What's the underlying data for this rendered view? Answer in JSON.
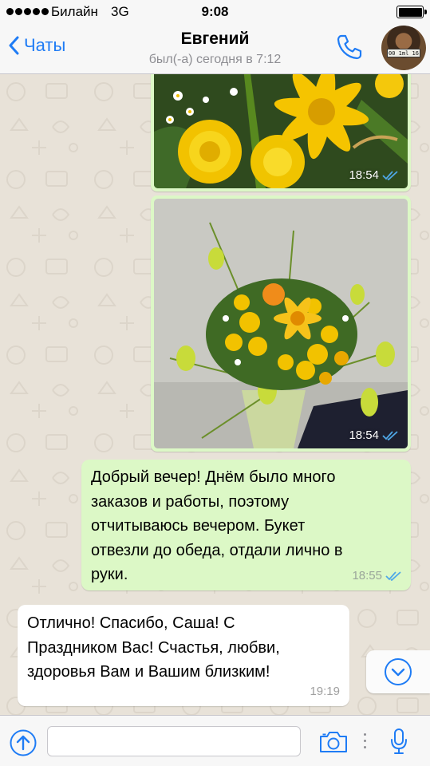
{
  "status_bar": {
    "carrier": "Билайн",
    "network": "3G",
    "time": "9:08"
  },
  "header": {
    "back_label": "Чаты",
    "contact_name": "Евгений",
    "last_seen": "был(-а) сегодня в 7:12",
    "avatar_plate": "00 1ml 16"
  },
  "messages": [
    {
      "type": "image",
      "direction": "outgoing",
      "subject": "yellow-flowers-closeup",
      "time": "18:54",
      "status": "read"
    },
    {
      "type": "image",
      "direction": "outgoing",
      "subject": "yellow-bouquet",
      "time": "18:54",
      "status": "read"
    },
    {
      "type": "text",
      "direction": "outgoing",
      "lines": [
        "Добрый вечер! Днём было много",
        "заказов и работы, поэтому",
        "отчитываюсь вечером. Букет",
        "отвезли до обеда, отдали лично в",
        "руки."
      ],
      "time": "18:55",
      "status": "read"
    },
    {
      "type": "text",
      "direction": "incoming",
      "lines": [
        "Отлично! Спасибо, Саша! С",
        "Праздником Вас! Счастья, любви,",
        "здоровья Вам и Вашим близким!"
      ],
      "time": "19:19"
    }
  ],
  "input": {
    "placeholder": ""
  },
  "colors": {
    "accent": "#1f7cf5",
    "outgoing_bubble": "#dcf8c6",
    "incoming_bubble": "#ffffff",
    "wallpaper": "#e8e2d8",
    "read_ticks": "#4fa8e8"
  }
}
